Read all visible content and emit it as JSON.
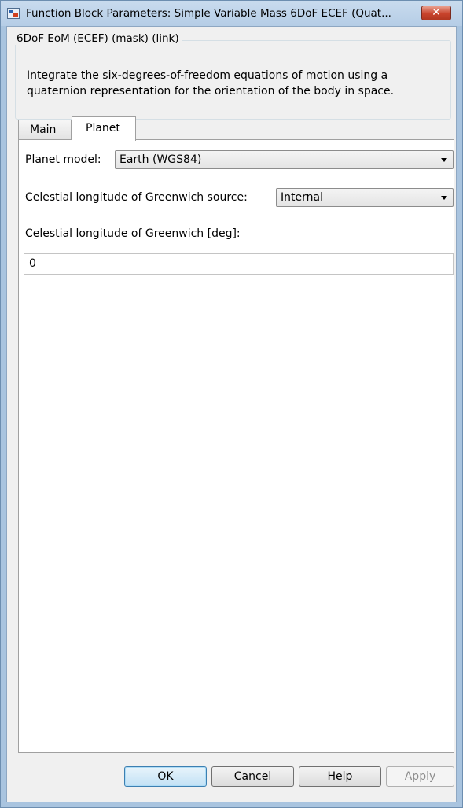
{
  "window": {
    "title": "Function Block Parameters: Simple Variable Mass 6DoF ECEF (Quat...",
    "close_glyph": "✕"
  },
  "group": {
    "legend": "6DoF EoM (ECEF) (mask) (link)",
    "description": "Integrate the six-degrees-of-freedom equations of motion using a quaternion representation for the orientation of the body in space."
  },
  "tabs": [
    {
      "label": "Main",
      "selected": false
    },
    {
      "label": "Planet",
      "selected": true
    }
  ],
  "planet": {
    "planet_model_label": "Planet model:",
    "planet_model_value": "Earth (WGS84)",
    "greenwich_source_label": "Celestial longitude of Greenwich source:",
    "greenwich_source_value": "Internal",
    "greenwich_label": "Celestial longitude of Greenwich [deg]:",
    "greenwich_value": "0"
  },
  "buttons": {
    "ok": "OK",
    "cancel": "Cancel",
    "help": "Help",
    "apply": "Apply"
  },
  "colors": {
    "window_frame": "#a9c4df",
    "close_button": "#c8432c",
    "default_button_border": "#3c7fb1"
  },
  "icons": {
    "app": "simulink-block-icon",
    "close": "close-icon",
    "dropdown": "chevron-down-icon"
  }
}
